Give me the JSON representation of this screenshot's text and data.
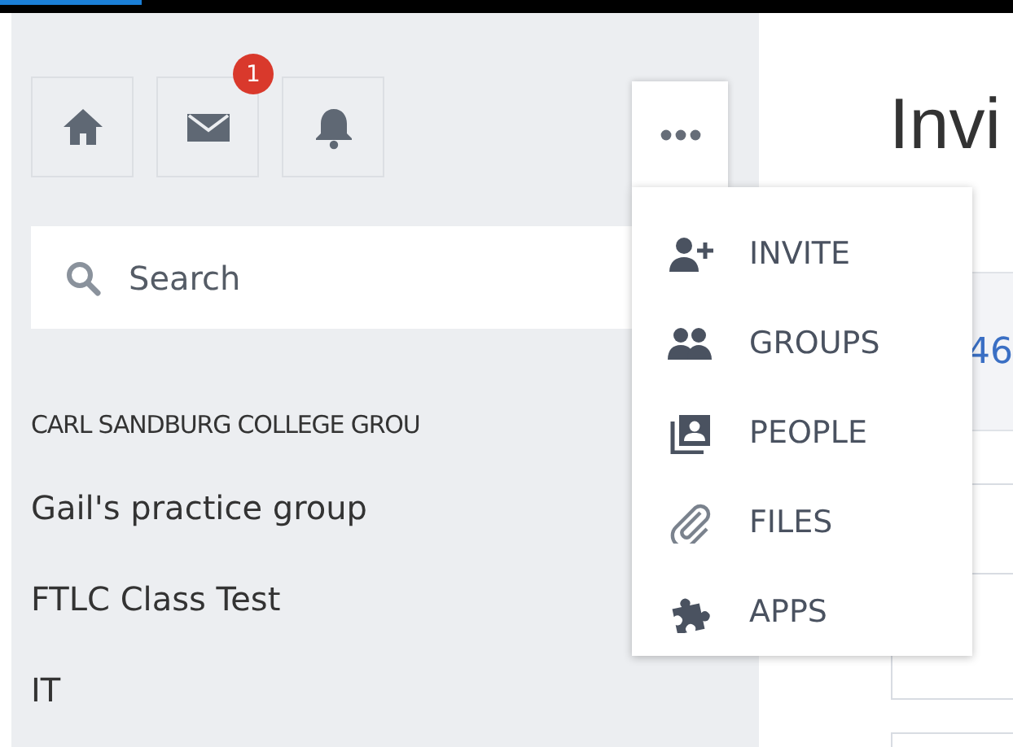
{
  "progress": {
    "level": 0.14
  },
  "toolbar": {
    "buttons": [
      {
        "kind": "home"
      },
      {
        "kind": "mail",
        "badge": "1"
      },
      {
        "kind": "bell"
      }
    ]
  },
  "search": {
    "placeholder": "Search"
  },
  "section_heading": "CARL SANDBURG COLLEGE GROU",
  "groups": [
    "Gail's practice group",
    "FTLC Class Test",
    "IT"
  ],
  "menu": {
    "expanded": true,
    "items": [
      {
        "kind": "invite",
        "label": "INVITE"
      },
      {
        "kind": "groups",
        "label": "GROUPS"
      },
      {
        "kind": "people",
        "label": "PEOPLE"
      },
      {
        "kind": "files",
        "label": "FILES"
      },
      {
        "kind": "apps",
        "label": "APPS"
      }
    ]
  },
  "main": {
    "title": "Invi",
    "card_value": "46"
  }
}
